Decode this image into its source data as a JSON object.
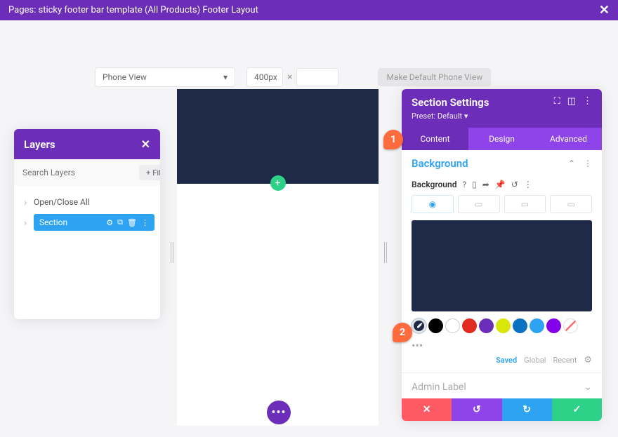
{
  "topbar": {
    "title": "Pages: sticky footer bar template (All Products) Footer Layout"
  },
  "toolbar": {
    "device_label": "Phone View",
    "width_value": "400px",
    "make_default": "Make Default Phone View"
  },
  "layers": {
    "title": "Layers",
    "search_placeholder": "Search Layers",
    "filter_label": "Filter",
    "open_close": "Open/Close All",
    "section_label": "Section"
  },
  "settings": {
    "title": "Section Settings",
    "preset": "Preset: Default ▾",
    "tabs": {
      "content": "Content",
      "design": "Design",
      "advanced": "Advanced"
    },
    "background": {
      "heading": "Background",
      "label": "Background",
      "preview_color": "#1e2a47",
      "swatches": [
        "#000000",
        "#ffffff",
        "#e02b20",
        "#6c2eb9",
        "#d9e60b",
        "#0c71c3",
        "#2ea3f2",
        "#8300e9"
      ],
      "filters": {
        "saved": "Saved",
        "global": "Global",
        "recent": "Recent"
      }
    },
    "admin_label": "Admin Label"
  },
  "steps": {
    "s1": "1",
    "s2": "2"
  }
}
